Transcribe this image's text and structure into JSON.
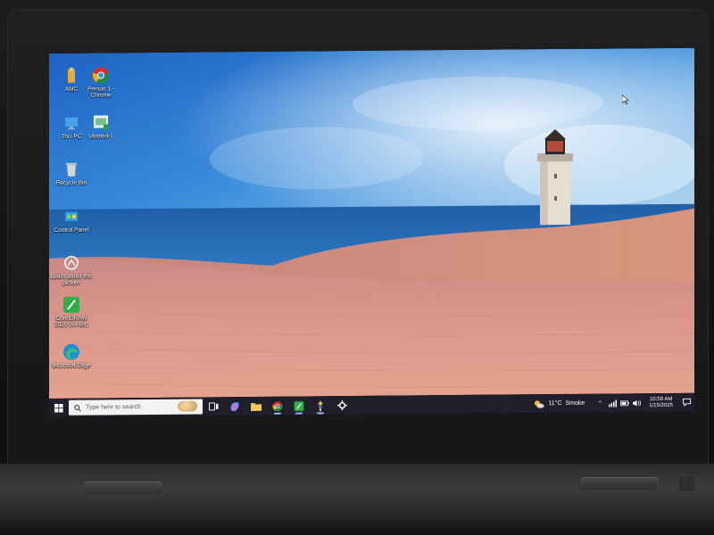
{
  "desktop": {
    "icons": [
      {
        "label": "AMC",
        "icon": "folder-icon"
      },
      {
        "label": "Person 1 - Chrome",
        "icon": "chrome-icon"
      },
      {
        "label": "This PC",
        "icon": "computer-icon"
      },
      {
        "label": "Untitled-1",
        "icon": "document-icon"
      },
      {
        "label": "Recycle Bin",
        "icon": "recycle-bin-icon"
      },
      {
        "label": "Control Panel",
        "icon": "control-panel-icon"
      },
      {
        "label": "Learn about this picture",
        "icon": "camera-icon"
      },
      {
        "label": "CorelDRAW 2020 (64-Bit)",
        "icon": "coreldraw-icon"
      },
      {
        "label": "Microsoft Edge",
        "icon": "edge-icon"
      }
    ]
  },
  "taskbar": {
    "search_placeholder": "Type here to search",
    "apps": [
      {
        "name": "Task View",
        "icon": "task-view-icon"
      },
      {
        "name": "Copilot",
        "icon": "copilot-icon"
      },
      {
        "name": "File Explorer",
        "icon": "file-explorer-icon"
      },
      {
        "name": "Google Chrome",
        "icon": "chrome-icon"
      },
      {
        "name": "CorelDRAW",
        "icon": "coreldraw-icon"
      },
      {
        "name": "Inkscape",
        "icon": "app-icon"
      },
      {
        "name": "Settings",
        "icon": "gear-icon"
      }
    ],
    "weather": {
      "temp": "11°C",
      "condition": "Smoke"
    },
    "clock": {
      "time": "10:59 AM",
      "date": "1/15/2025"
    }
  },
  "colors": {
    "taskbar": "#1f1e2b",
    "sky": "#2f7fd6",
    "sea": "#1f5fa8",
    "sand": "#d9958a"
  }
}
